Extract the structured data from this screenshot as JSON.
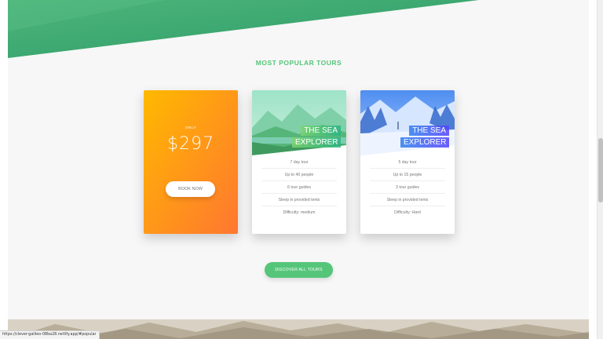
{
  "section": {
    "title": "MOST POPULAR TOURS"
  },
  "price_card": {
    "only_label": "ONLY",
    "price": "$297",
    "book_label": "BOOK NOW"
  },
  "tours": [
    {
      "title": [
        "THE SEA",
        "EXPLORER"
      ],
      "details": [
        "7 day tour",
        "Up to 40 people",
        "6 tour guides",
        "Sleep in provided tents",
        "Difficulty: medium"
      ]
    },
    {
      "title": [
        "THE SEA",
        "EXPLORER"
      ],
      "details": [
        "5 day tour",
        "Up to 15 people",
        "3 tour guides",
        "Sleep in provided tents",
        "Difficulty: Hard"
      ]
    }
  ],
  "discover_label": "DISCOVER ALL TOURS",
  "status_url": "https://clever-galileo-08ba28.netlify.app/#popular",
  "colors": {
    "primary": "#55c57a",
    "orange_start": "#ffb900",
    "orange_end": "#ff7730",
    "blue_start": "#2f80ed",
    "blue_end": "#5643fa"
  }
}
